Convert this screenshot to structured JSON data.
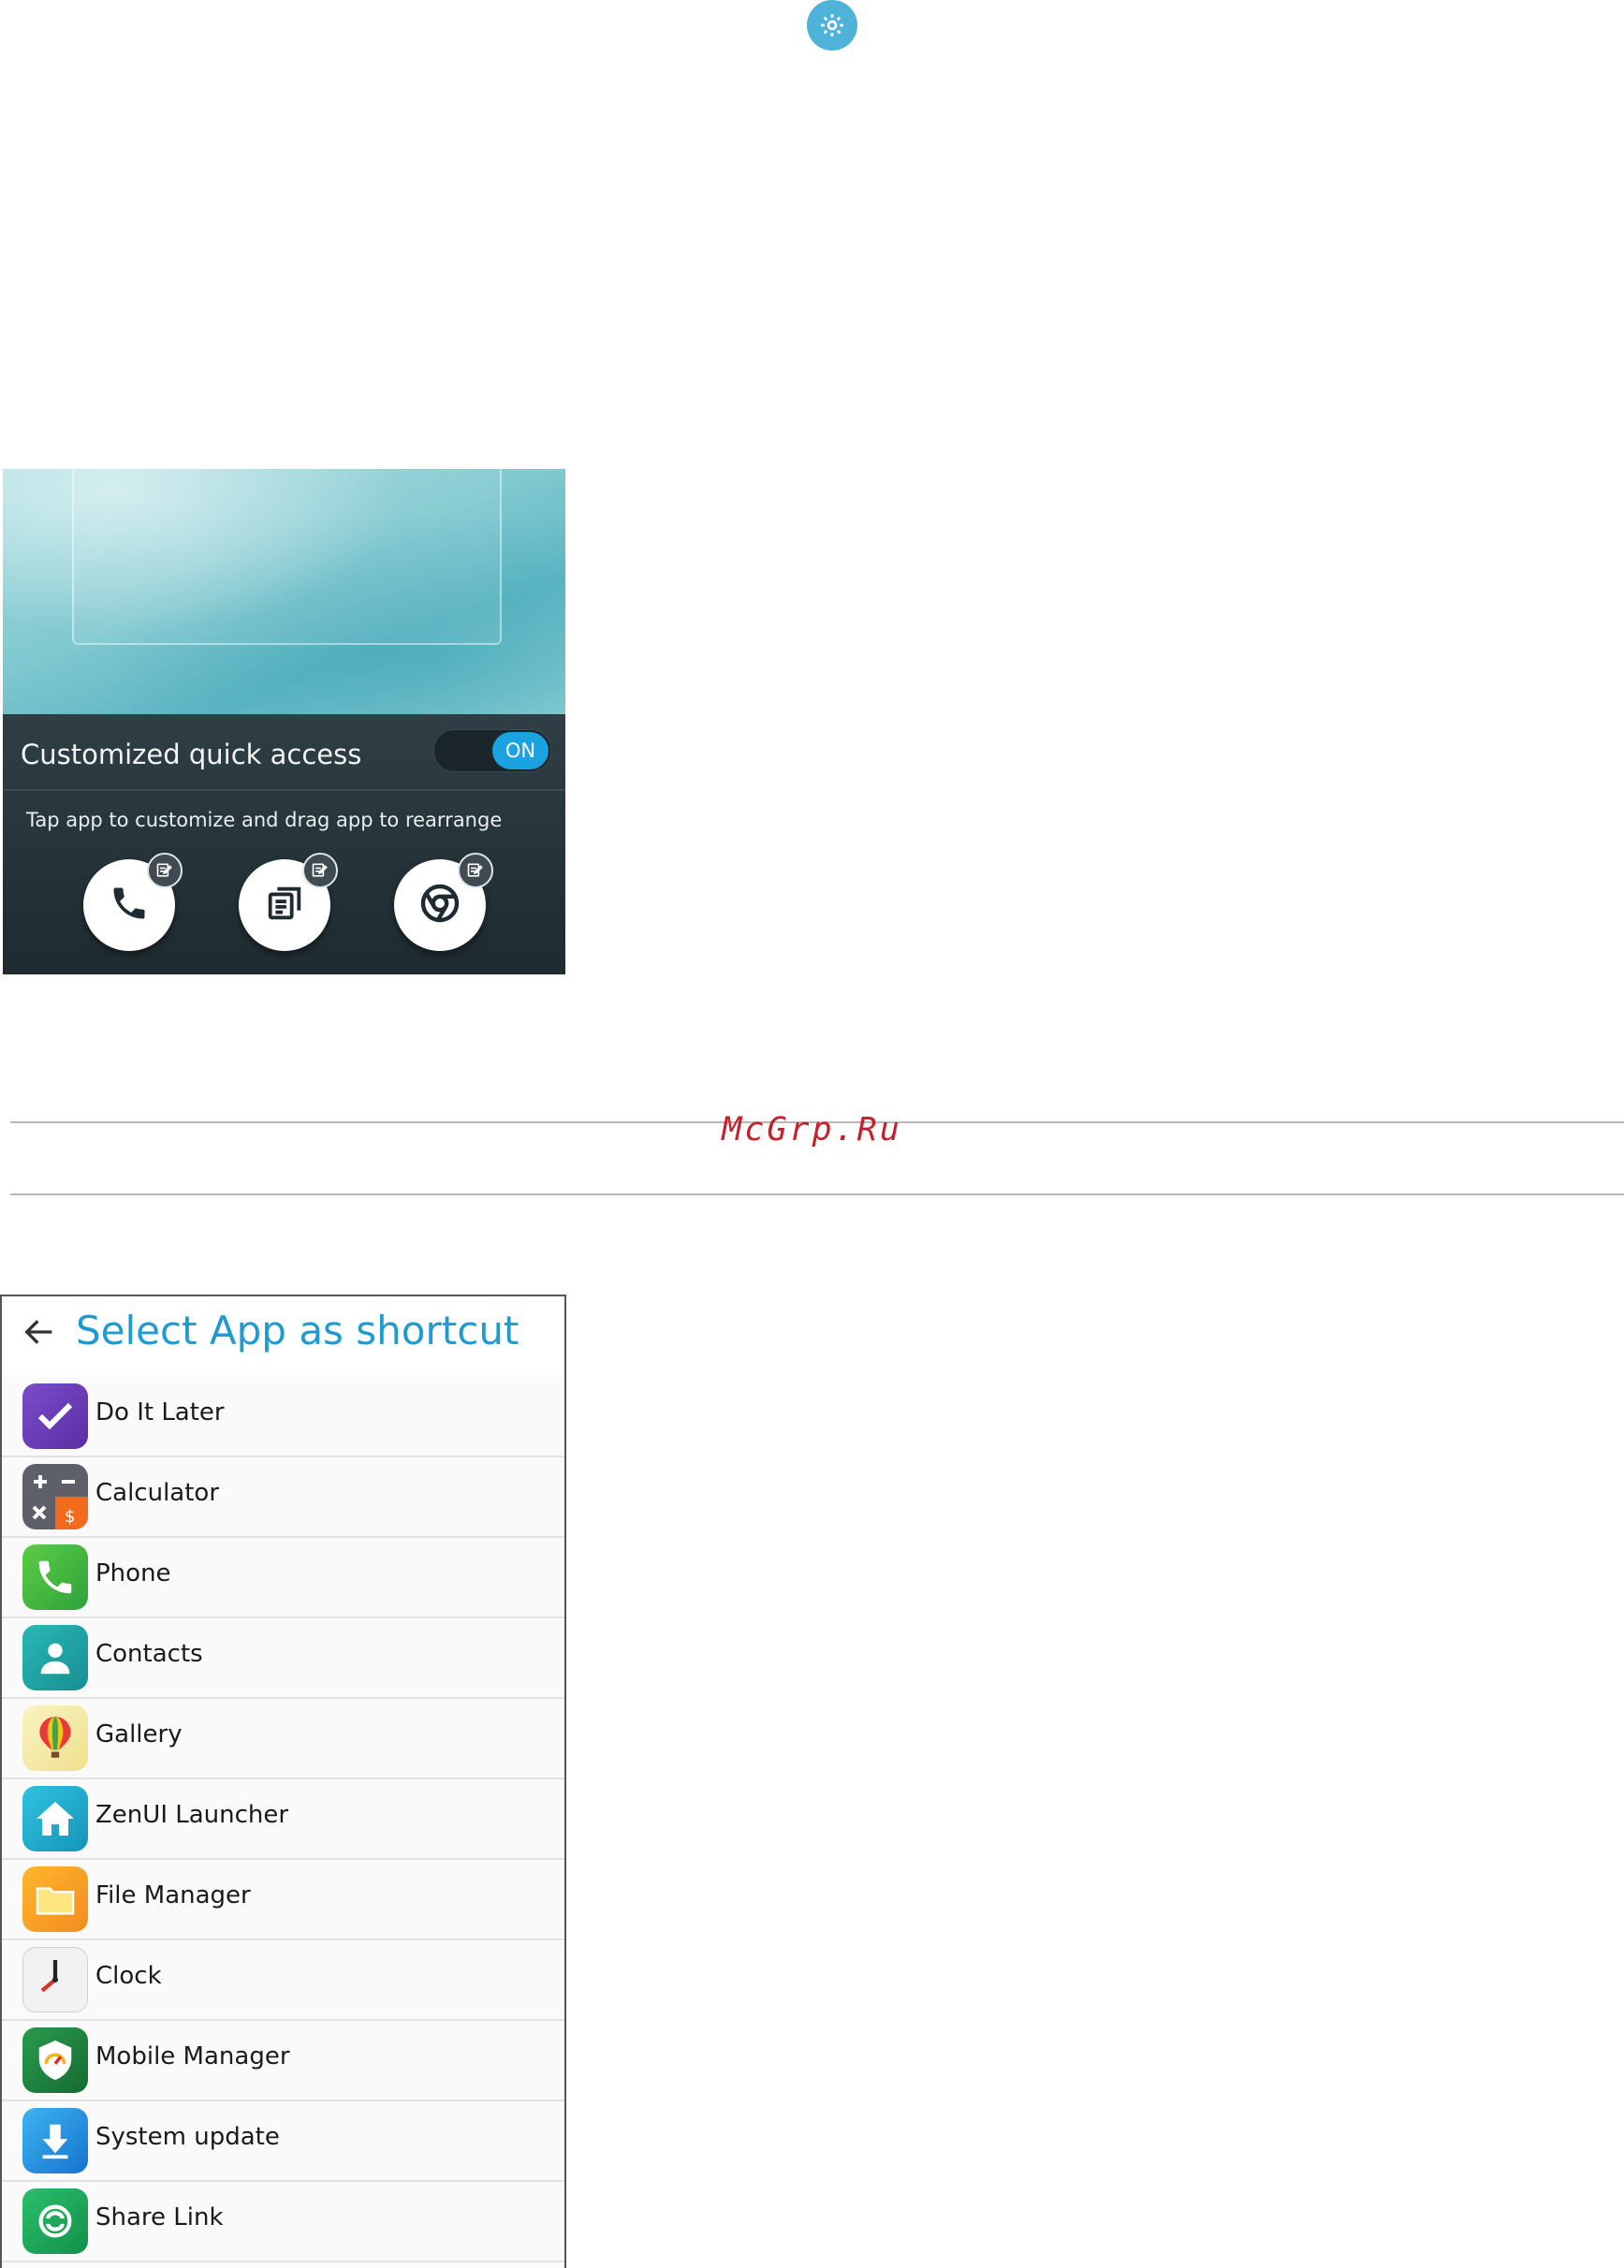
{
  "top": {
    "settings_icon": "gear-icon"
  },
  "quick_access": {
    "title": "Customized quick access",
    "toggle_label": "ON",
    "hint": "Tap app to customize and drag app to rearrange",
    "apps": [
      {
        "icon": "phone-icon"
      },
      {
        "icon": "messaging-icon"
      },
      {
        "icon": "chrome-icon"
      }
    ],
    "accent": "#1aa3e0"
  },
  "watermark": "McGrp.Ru",
  "select_app": {
    "title": "Select App as shortcut",
    "accent": "#1f9bd1",
    "apps": [
      {
        "label": "Do It Later",
        "icon": "do-it-later-icon",
        "color": "#6a3fb5"
      },
      {
        "label": "Calculator",
        "icon": "calculator-icon",
        "color": "#5d6068"
      },
      {
        "label": "Phone",
        "icon": "phone-icon",
        "color": "#3fb34a"
      },
      {
        "label": "Contacts",
        "icon": "contacts-icon",
        "color": "#1fa9a8"
      },
      {
        "label": "Gallery",
        "icon": "gallery-icon",
        "color": "#f4e79a"
      },
      {
        "label": "ZenUI Launcher",
        "icon": "launcher-icon",
        "color": "#1fb0cf"
      },
      {
        "label": "File Manager",
        "icon": "folder-icon",
        "color": "#f5a623"
      },
      {
        "label": "Clock",
        "icon": "clock-icon",
        "color": "#ececec"
      },
      {
        "label": "Mobile Manager",
        "icon": "shield-icon",
        "color": "#1e7f3c"
      },
      {
        "label": "System update",
        "icon": "download-icon",
        "color": "#1c8fe0"
      },
      {
        "label": "Share Link",
        "icon": "share-link-icon",
        "color": "#19a35a"
      }
    ]
  }
}
